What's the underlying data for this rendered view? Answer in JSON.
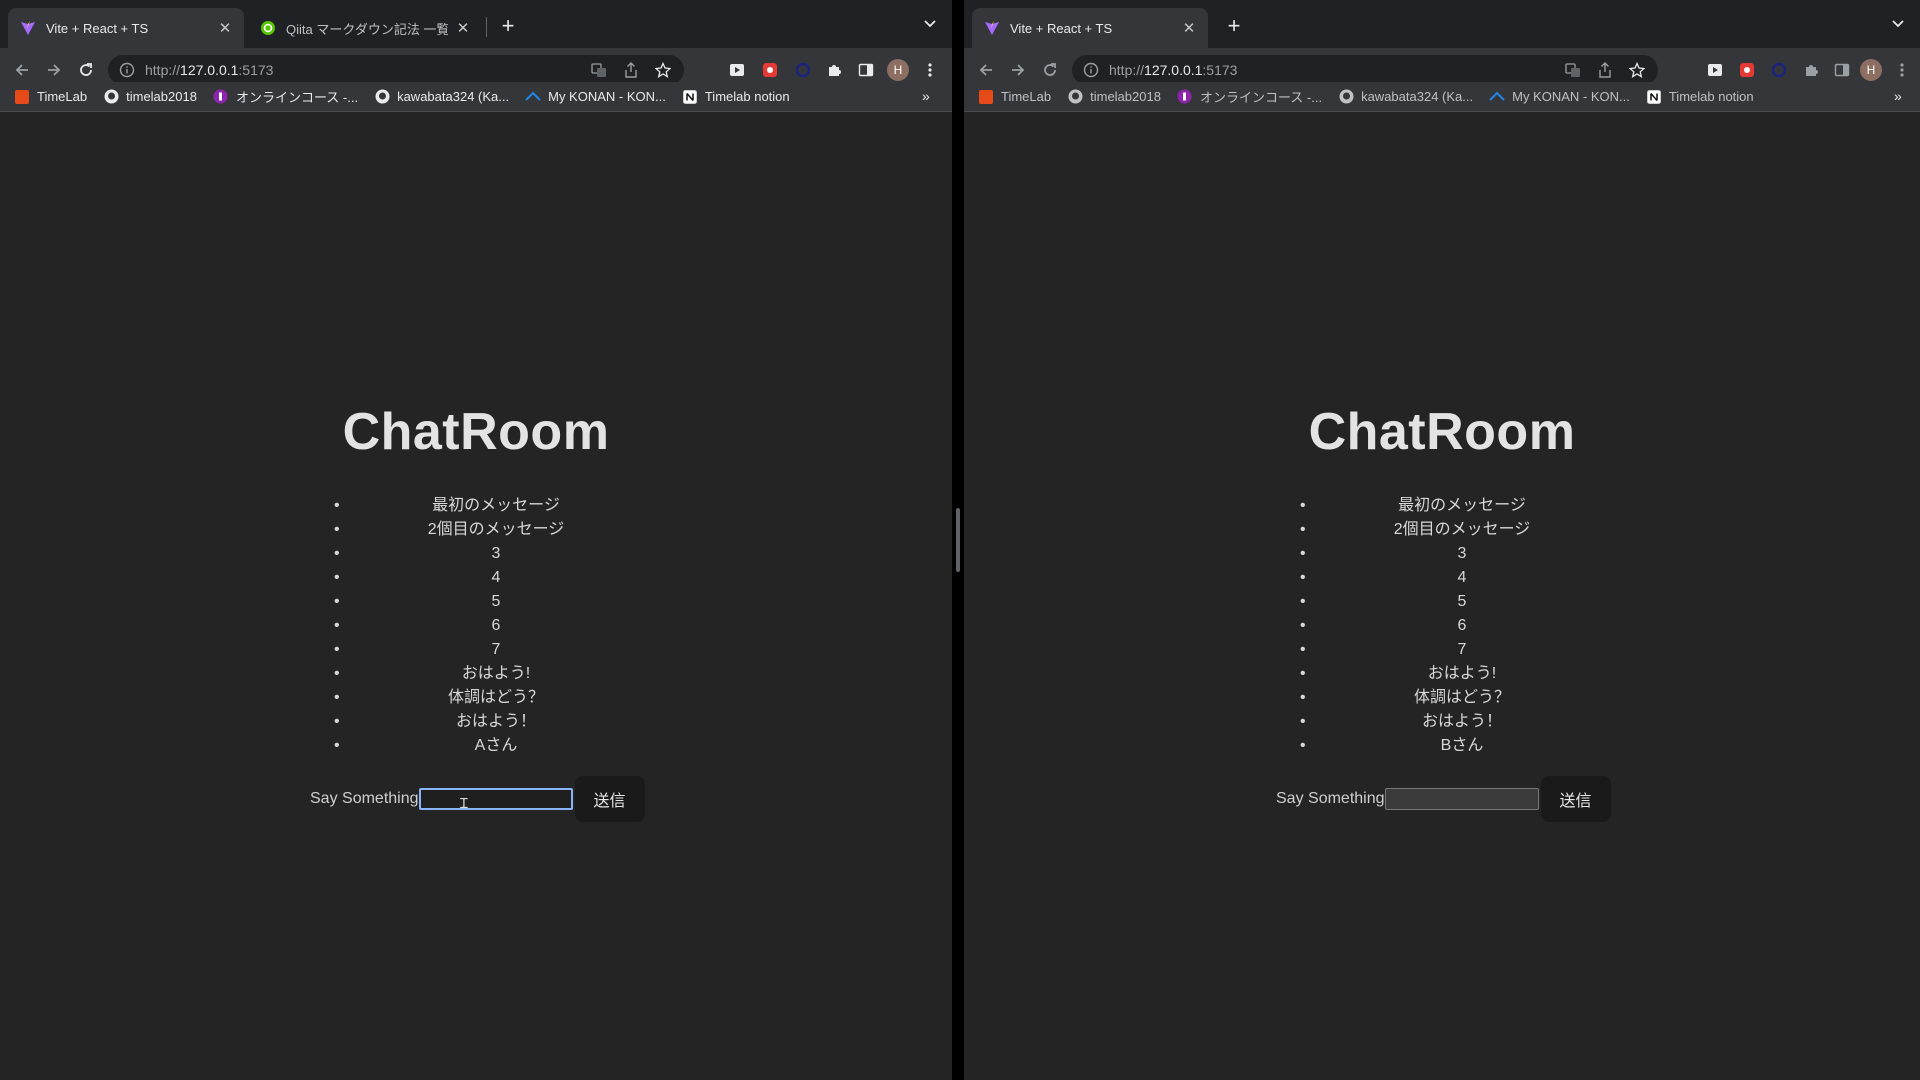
{
  "colors": {
    "chrome_tab_bg": "#202124",
    "chrome_toolbar": "#35363a",
    "page_bg": "#242424",
    "focus_ring": "#8ab4f8",
    "avatar": "#8d6e63"
  },
  "left_window": {
    "tabs": [
      {
        "title": "Vite + React + TS",
        "icon": "vite-icon",
        "active": true
      },
      {
        "title": "Qiita マークダウン記法 一覧表・チ",
        "icon": "qiita-icon",
        "active": false
      }
    ],
    "url_prefix": "http://",
    "url_host": "127.0.0.1",
    "url_port": ":5173",
    "avatar_letter": "H",
    "bookmarks": [
      {
        "label": "TimeLab",
        "icon": "timelab-icon"
      },
      {
        "label": "timelab2018",
        "icon": "github-icon"
      },
      {
        "label": "オンラインコース -...",
        "icon": "course-icon"
      },
      {
        "label": "kawabata324 (Ka...",
        "icon": "github-icon"
      },
      {
        "label": "My KONAN - KON...",
        "icon": "konan-icon"
      },
      {
        "label": "Timelab notion",
        "icon": "notion-icon"
      }
    ],
    "page": {
      "title": "ChatRoom",
      "messages": [
        "最初のメッセージ",
        "2個目のメッセージ",
        "3",
        "4",
        "5",
        "6",
        "7",
        "おはよう!",
        "体調はどう？",
        "おはよう！",
        "Aさん"
      ],
      "input_label": "Say Something",
      "input_value": "",
      "send_label": "送信"
    }
  },
  "right_window": {
    "tabs": [
      {
        "title": "Vite + React + TS",
        "icon": "vite-icon",
        "active": true
      }
    ],
    "url_prefix": "http://",
    "url_host": "127.0.0.1",
    "url_port": ":5173",
    "avatar_letter": "H",
    "bookmarks": [
      {
        "label": "TimeLab",
        "icon": "timelab-icon"
      },
      {
        "label": "timelab2018",
        "icon": "github-icon"
      },
      {
        "label": "オンラインコース -...",
        "icon": "course-icon"
      },
      {
        "label": "kawabata324 (Ka...",
        "icon": "github-icon"
      },
      {
        "label": "My KONAN - KON...",
        "icon": "konan-icon"
      },
      {
        "label": "Timelab notion",
        "icon": "notion-icon"
      }
    ],
    "page": {
      "title": "ChatRoom",
      "messages": [
        "最初のメッセージ",
        "2個目のメッセージ",
        "3",
        "4",
        "5",
        "6",
        "7",
        "おはよう!",
        "体調はどう？",
        "おはよう！",
        "Bさん"
      ],
      "input_label": "Say Something",
      "input_value": "",
      "send_label": "送信"
    }
  }
}
